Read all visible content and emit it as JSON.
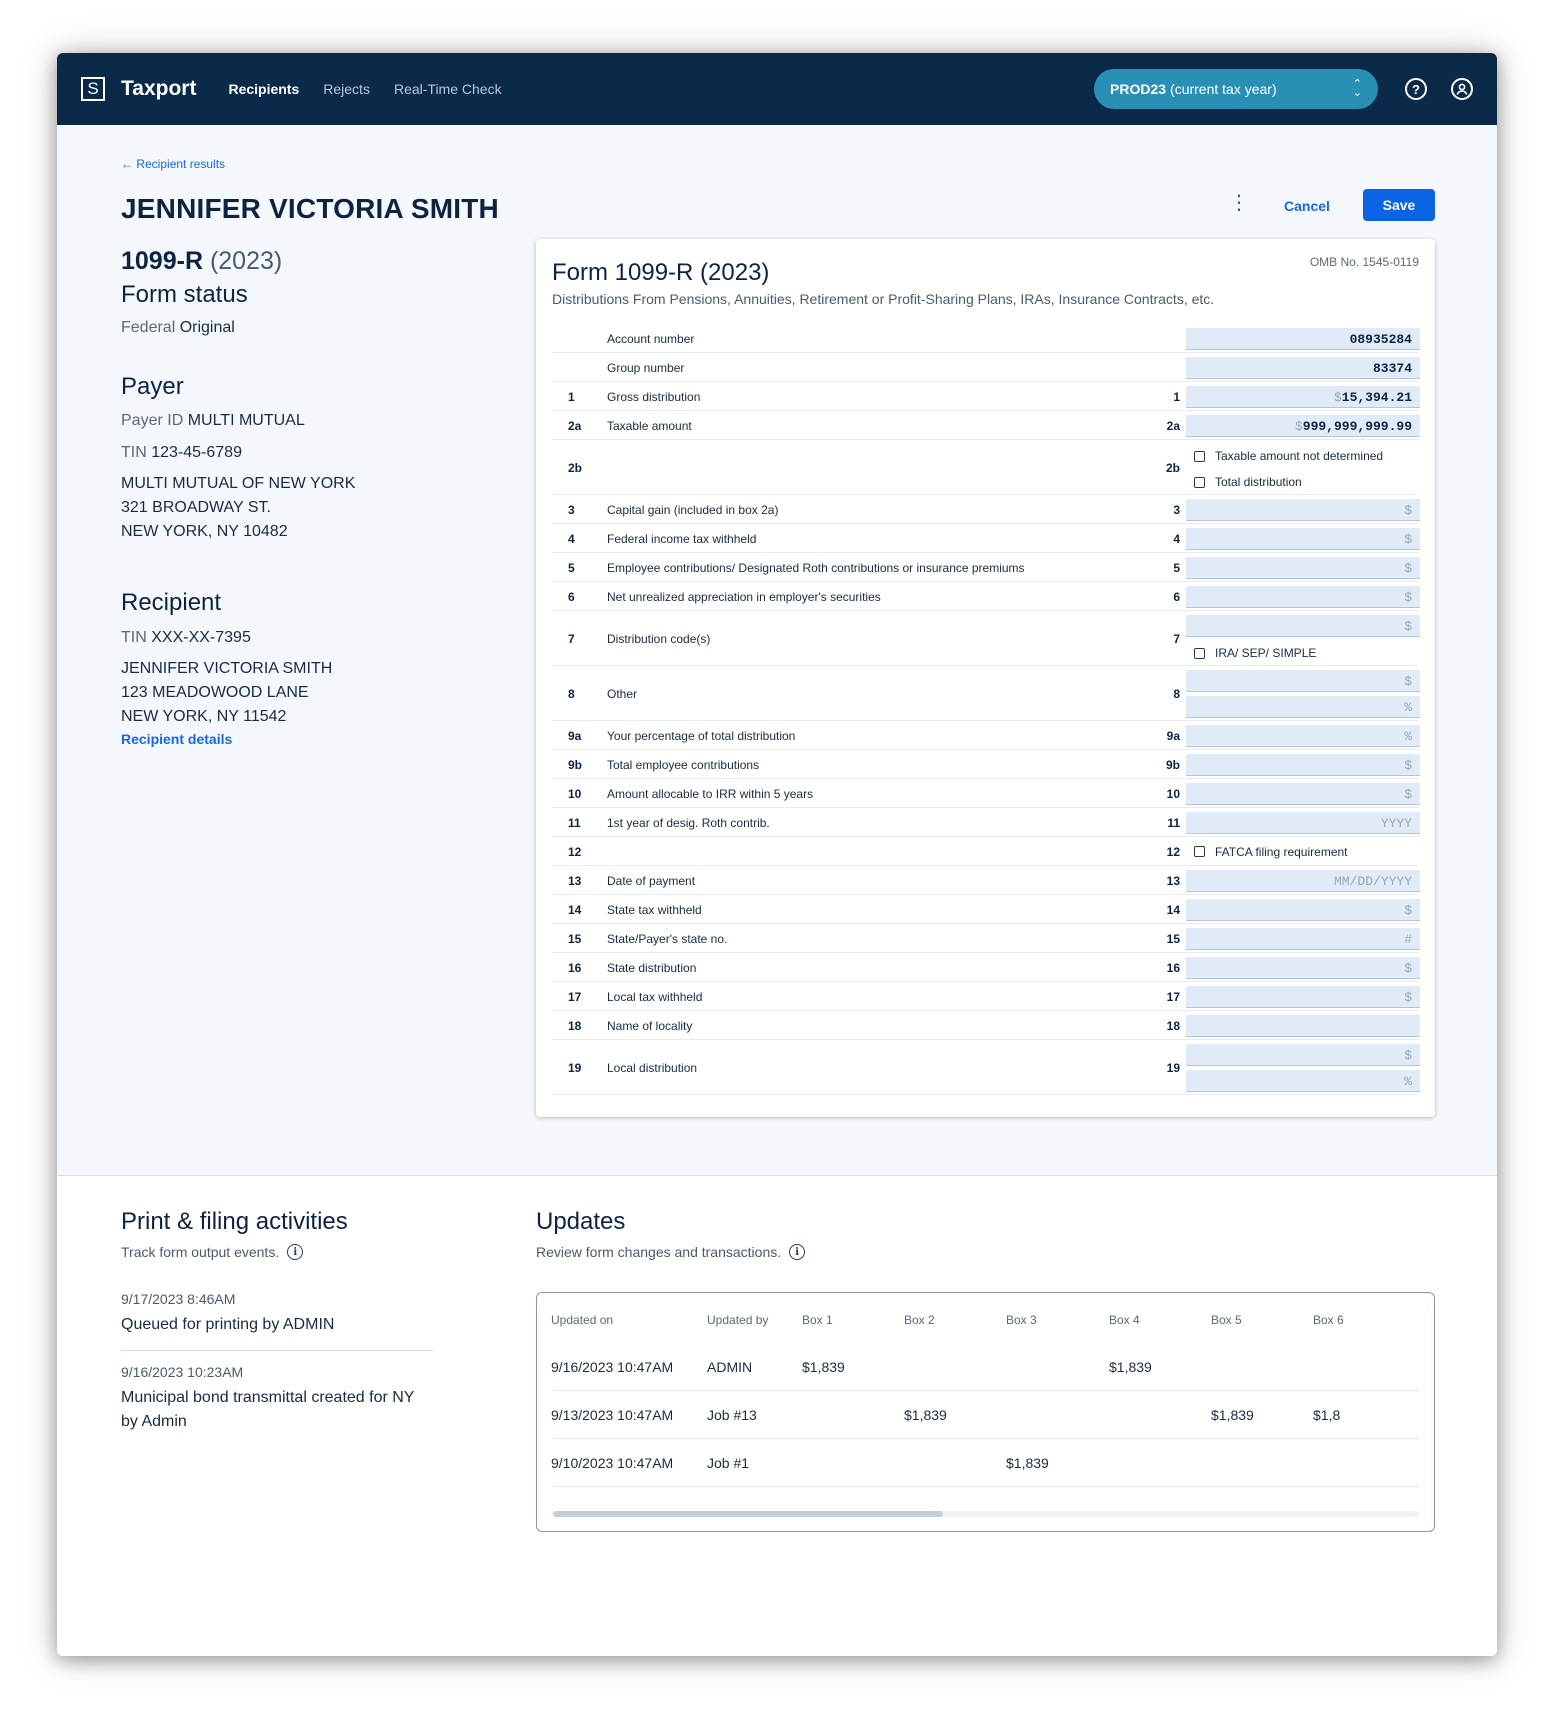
{
  "header": {
    "logo_letter": "S",
    "brand": "Taxport",
    "nav": [
      "Recipients",
      "Rejects",
      "Real-Time Check"
    ],
    "year_code": "PROD23",
    "year_label": "(current tax year)",
    "help_icon": "question-icon",
    "account_icon": "user-icon"
  },
  "breadcrumb": "Recipient results",
  "page_title": "JENNIFER VICTORIA SMITH",
  "form_name": "1099-R",
  "form_year": "(2023)",
  "actions": {
    "cancel": "Cancel",
    "save": "Save"
  },
  "form_status": {
    "title": "Form status",
    "label": "Federal",
    "value": "Original"
  },
  "payer": {
    "title": "Payer",
    "id_label": "Payer ID",
    "id_value": "MULTI MUTUAL",
    "tin_label": "TIN",
    "tin_value": "123-45-6789",
    "address": [
      "MULTI MUTUAL OF NEW YORK",
      "321 BROADWAY ST.",
      "NEW YORK, NY 10482"
    ]
  },
  "recipient": {
    "title": "Recipient",
    "tin_label": "TIN",
    "tin_value": "XXX-XX-7395",
    "address": [
      "JENNIFER VICTORIA SMITH",
      "123 MEADOWOOD LANE",
      "NEW YORK, NY 11542"
    ],
    "details_link": "Recipient details"
  },
  "form": {
    "title": "Form 1099-R (2023)",
    "omb": "OMB No. 1545-0119",
    "subtitle": "Distributions From Pensions, Annuities, Retirement or Profit-Sharing Plans, IRAs, Insurance Contracts, etc.",
    "rows": [
      {
        "num": "",
        "desc": "Account number",
        "h": 29,
        "fields": [
          {
            "type": "input",
            "value": "08935284"
          }
        ]
      },
      {
        "num": "",
        "desc": "Group number",
        "h": 29,
        "fields": [
          {
            "type": "input",
            "value": "83374"
          }
        ]
      },
      {
        "num": "1",
        "desc": "Gross distribution",
        "h": 29,
        "fields": [
          {
            "type": "input",
            "prefix": "$",
            "value": "15,394.21"
          }
        ]
      },
      {
        "num": "2a",
        "desc": "Taxable amount",
        "h": 29,
        "fields": [
          {
            "type": "input",
            "prefix": "$",
            "value": "999,999,999.99"
          }
        ]
      },
      {
        "num": "2b",
        "desc": "",
        "h": 55,
        "fields": [
          {
            "type": "checkbox",
            "label": "Taxable amount not determined"
          },
          {
            "type": "checkbox",
            "label": "Total distribution"
          }
        ]
      },
      {
        "num": "3",
        "desc": "Capital gain (included in box 2a)",
        "h": 29,
        "fields": [
          {
            "type": "input",
            "placeholder": "$"
          }
        ]
      },
      {
        "num": "4",
        "desc": "Federal income tax withheld",
        "h": 29,
        "fields": [
          {
            "type": "input",
            "placeholder": "$"
          }
        ]
      },
      {
        "num": "5",
        "desc": "Employee contributions/ Designated Roth contributions or insurance premiums",
        "h": 29,
        "fields": [
          {
            "type": "input",
            "placeholder": "$"
          }
        ]
      },
      {
        "num": "6",
        "desc": "Net unrealized appreciation in employer's securities",
        "h": 29,
        "fields": [
          {
            "type": "input",
            "placeholder": "$"
          }
        ]
      },
      {
        "num": "7",
        "desc": "Distribution code(s)",
        "h": 55,
        "fields": [
          {
            "type": "input",
            "placeholder": "$"
          },
          {
            "type": "checkbox",
            "label": "IRA/ SEP/ SIMPLE"
          }
        ]
      },
      {
        "num": "8",
        "desc": "Other",
        "h": 55,
        "fields": [
          {
            "type": "input",
            "placeholder": "$"
          },
          {
            "type": "input",
            "placeholder": "%"
          }
        ]
      },
      {
        "num": "9a",
        "desc": "Your percentage of total distribution",
        "h": 29,
        "fields": [
          {
            "type": "input",
            "placeholder": "%"
          }
        ]
      },
      {
        "num": "9b",
        "desc": "Total employee contributions",
        "h": 29,
        "fields": [
          {
            "type": "input",
            "placeholder": "$"
          }
        ]
      },
      {
        "num": "10",
        "desc": "Amount allocable to IRR within 5 years",
        "h": 29,
        "fields": [
          {
            "type": "input",
            "placeholder": "$"
          }
        ]
      },
      {
        "num": "11",
        "desc": "1st year of desig. Roth contrib.",
        "h": 29,
        "fields": [
          {
            "type": "input",
            "placeholder": "YYYY"
          }
        ]
      },
      {
        "num": "12",
        "desc": "",
        "h": 29,
        "fields": [
          {
            "type": "checkbox",
            "label": "FATCA filing requirement"
          }
        ]
      },
      {
        "num": "13",
        "desc": "Date of payment",
        "h": 29,
        "fields": [
          {
            "type": "input",
            "placeholder": "MM/DD/YYYY"
          }
        ]
      },
      {
        "num": "14",
        "desc": "State tax withheld",
        "h": 29,
        "fields": [
          {
            "type": "input",
            "placeholder": "$"
          }
        ]
      },
      {
        "num": "15",
        "desc": "State/Payer's state no.",
        "h": 29,
        "fields": [
          {
            "type": "input",
            "placeholder": "#"
          }
        ]
      },
      {
        "num": "16",
        "desc": "State distribution",
        "h": 29,
        "fields": [
          {
            "type": "input",
            "placeholder": "$"
          }
        ]
      },
      {
        "num": "17",
        "desc": "Local tax withheld",
        "h": 29,
        "fields": [
          {
            "type": "input",
            "placeholder": "$"
          }
        ]
      },
      {
        "num": "18",
        "desc": "Name of locality",
        "h": 29,
        "fields": [
          {
            "type": "input",
            "placeholder": ""
          }
        ]
      },
      {
        "num": "19",
        "desc": "Local distribution",
        "h": 55,
        "fields": [
          {
            "type": "input",
            "placeholder": "$"
          },
          {
            "type": "input",
            "placeholder": "%"
          }
        ]
      }
    ]
  },
  "activities": {
    "title": "Print & filing activities",
    "subtitle": "Track form output events.",
    "items": [
      {
        "date": "9/17/2023 8:46AM",
        "text": "Queued for printing by ADMIN"
      },
      {
        "date": "9/16/2023 10:23AM",
        "text": "Municipal bond transmittal created for NY by Admin"
      }
    ]
  },
  "updates": {
    "title": "Updates",
    "subtitle": "Review form changes and transactions.",
    "columns": [
      "Updated on",
      "Updated by",
      "Box 1",
      "Box 2",
      "Box 3",
      "Box 4",
      "Box 5",
      "Box 6"
    ],
    "rows": [
      [
        "9/16/2023 10:47AM",
        "ADMIN",
        "$1,839",
        "",
        "",
        "$1,839",
        "",
        ""
      ],
      [
        "9/13/2023 10:47AM",
        "Job #13",
        "",
        "$1,839",
        "",
        "",
        "$1,839",
        "$1,8"
      ],
      [
        "9/10/2023 10:47AM",
        "Job #1",
        "",
        "",
        "$1,839",
        "",
        "",
        ""
      ]
    ],
    "scroll_fraction": 0.45
  }
}
